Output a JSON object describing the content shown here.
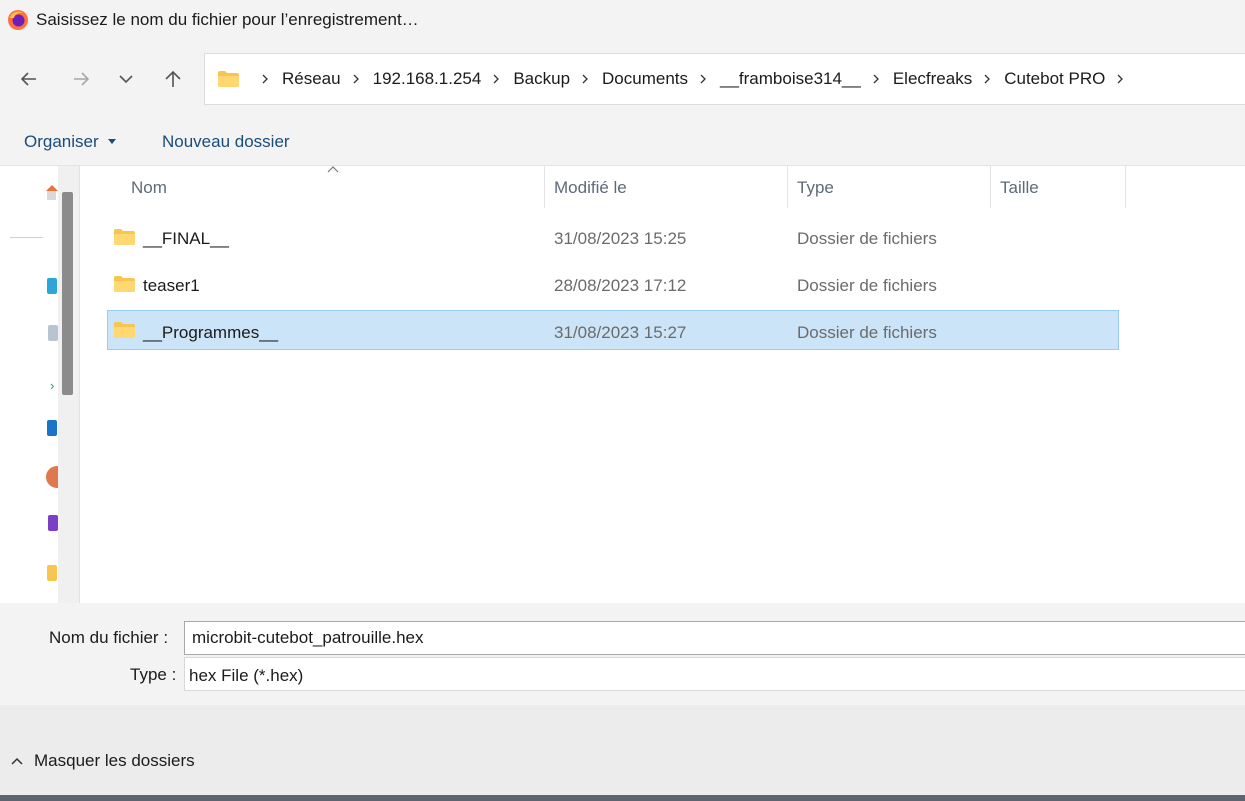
{
  "window": {
    "title": "Saisissez le nom du fichier pour l’enregistrement…"
  },
  "navigation": {
    "breadcrumbs": [
      "Réseau",
      "192.168.1.254",
      "Backup",
      "Documents",
      "__framboise314__",
      "Elecfreaks",
      "Cutebot PRO"
    ]
  },
  "toolbar": {
    "organize_label": "Organiser",
    "new_folder_label": "Nouveau dossier"
  },
  "columns": {
    "name": "Nom",
    "modified": "Modifié le",
    "type": "Type",
    "size": "Taille"
  },
  "rows": [
    {
      "name": "__FINAL__",
      "modified": "31/08/2023 15:25",
      "type": "Dossier de fichiers",
      "size": ""
    },
    {
      "name": "teaser1",
      "modified": "28/08/2023 17:12",
      "type": "Dossier de fichiers",
      "size": ""
    },
    {
      "name": "__Programmes__",
      "modified": "31/08/2023 15:27",
      "type": "Dossier de fichiers",
      "size": "",
      "selected": true
    }
  ],
  "form": {
    "filename_label": "Nom du fichier :",
    "filename_value": "microbit-cutebot_patrouille.hex",
    "type_label": "Type :",
    "type_value": "hex File (*.hex)"
  },
  "footer": {
    "hide_folders_label": "Masquer les dossiers"
  },
  "colors": {
    "selection": "#cce4f7",
    "selection_border": "#99cdf2",
    "link": "#1a4c7c",
    "folder": "#f8c650"
  }
}
